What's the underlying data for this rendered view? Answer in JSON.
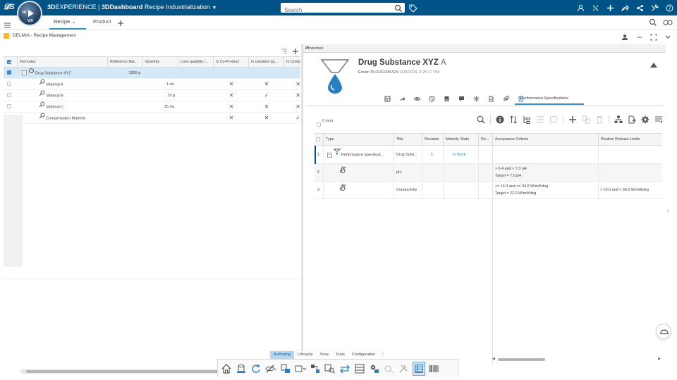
{
  "topbar": {
    "brand_bold": "3D",
    "brand_rest": "EXPERIENCE | ",
    "dashboard_bold": "3DDashboard",
    "dashboard_name": " Recipe Industrialization",
    "search_placeholder": "Search",
    "compass_labels": [
      "3D",
      "V,R"
    ]
  },
  "tabs": {
    "recipe_label": "Recipe",
    "product_label": "Product"
  },
  "app": {
    "title": "DELMIA - Recipe Management"
  },
  "left_grid": {
    "headers": [
      "Formulas",
      "Reference Bat...",
      "Quantity",
      "Loss quantity r...",
      "Is Co-Product",
      "Is constant qu...",
      "Is Comp"
    ],
    "rows": [
      {
        "name": "Drug Substance XYZ",
        "ref_batch": "1000 g",
        "quantity": "",
        "co_product": "",
        "constant": "",
        "comp": ""
      },
      {
        "name": "Material A",
        "ref_batch": "",
        "quantity": "1 mL",
        "co_product": "✕",
        "constant": "✕",
        "comp": "✕"
      },
      {
        "name": "Material B",
        "ref_batch": "",
        "quantity": "10 g",
        "co_product": "✕",
        "constant": "✓",
        "comp": "✕"
      },
      {
        "name": "Material C",
        "ref_batch": "",
        "quantity": "25 mL",
        "co_product": "✕",
        "constant": "✕",
        "comp": "✕"
      },
      {
        "name": "Compensation Material",
        "ref_batch": "",
        "quantity": "",
        "co_product": "✕",
        "constant": "✕",
        "comp": "✓"
      }
    ]
  },
  "properties": {
    "panel_title": "Properties",
    "object_title": "Drug Substance XYZ",
    "object_rev": "A",
    "owner": "Erwan PLOUGONVEN",
    "date": "3/29/2024, 4:25:17 PM",
    "active_tab": "Performance Specifications",
    "items_count": "0 item",
    "headers": [
      "Type",
      "Title",
      "Revision",
      "Maturity State",
      "De...",
      "Acceptance Criteria",
      "Routine Release Limits"
    ],
    "rows": [
      {
        "num": "1",
        "type": "Performance Specificat...",
        "title": "Drug Subs...",
        "revision": "1",
        "maturity": "In Work",
        "accept1": "",
        "accept2": "",
        "routine": ""
      },
      {
        "num": "2",
        "type": "",
        "title": "pH",
        "revision": "",
        "maturity": "",
        "accept1": "> 6.4 and < 7.3   pH",
        "accept2": "Target = 7.0   pH",
        "routine": ""
      },
      {
        "num": "3",
        "type": "",
        "title": "Conductivity",
        "revision": "",
        "maturity": "",
        "accept1": ">= 14.0 and <= 34.0   W/m/Kdeg",
        "accept2": "Target = 22.0   W/m/Kdeg",
        "routine": "> 10.0 and < 36.0   W/m/Kdeg"
      }
    ]
  },
  "action_bar": {
    "tabs": [
      "Authoring",
      "Lifecycle",
      "View",
      "Tools",
      "Configuration"
    ],
    "active_tab": "Authoring"
  },
  "colors": {
    "topbar": "#005386",
    "accent": "#368ec4",
    "selected_row": "#d4e8f6"
  }
}
